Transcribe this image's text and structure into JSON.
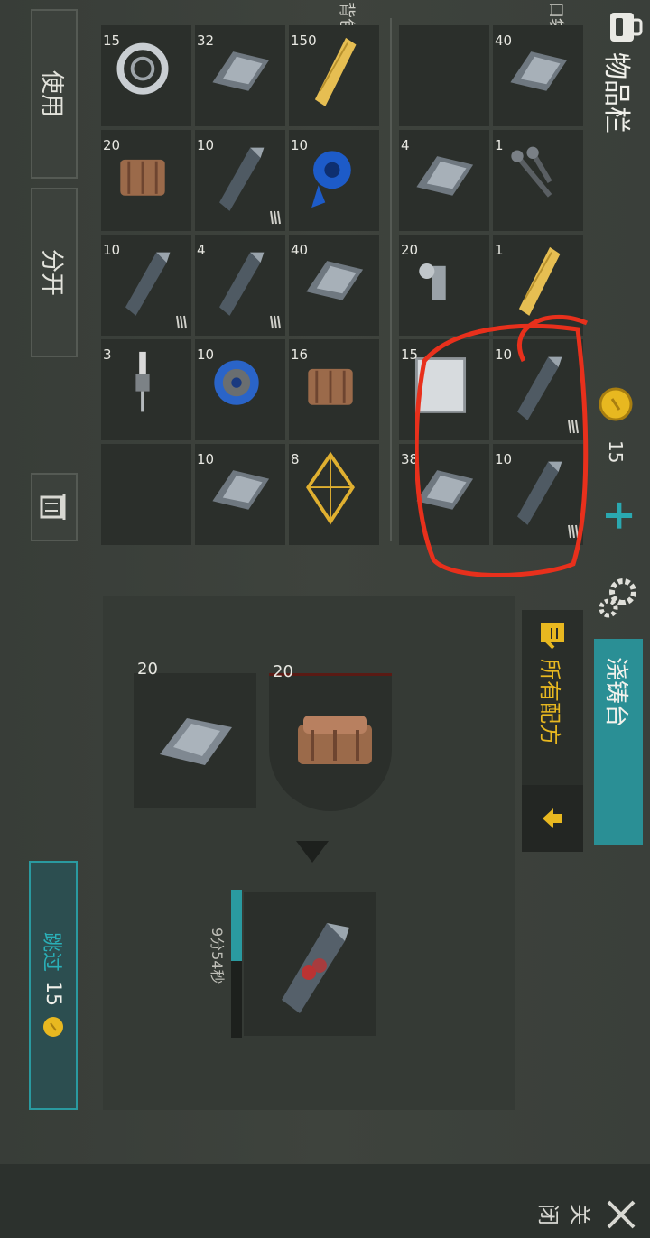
{
  "header": {
    "inventory_title": "物品栏",
    "pocket_label": "口袋",
    "backpack_label": "背包"
  },
  "currency": {
    "coins": "15",
    "add": "+"
  },
  "side_buttons": {
    "use": "使用",
    "split": "分开",
    "skip_label": "跳过",
    "skip_cost": "15"
  },
  "crafting": {
    "station_tab": "浇铸台",
    "all_recipes": "所有配方",
    "timer": "9分54秒",
    "ingredients": [
      {
        "icon": "clay-brick-icon",
        "count": "20"
      },
      {
        "icon": "iron-ingot-icon",
        "count": "20"
      }
    ],
    "result_icon": "iron-bar-icon"
  },
  "pocket": [
    [
      {
        "icon": "iron-ingot-icon",
        "count": "40"
      },
      {
        "icon": "screws-icon",
        "count": "1"
      },
      {
        "icon": "wood-plank-icon",
        "count": "1"
      },
      {
        "icon": "iron-bar-icon",
        "count": "10"
      },
      {
        "icon": "iron-bar-icon",
        "count": "10"
      }
    ],
    [
      {
        "icon": "empty",
        "count": ""
      },
      {
        "icon": "iron-ingot-icon",
        "count": "4"
      },
      {
        "icon": "nut-bolt-icon",
        "count": "20"
      },
      {
        "icon": "metal-sheet-icon",
        "count": "15"
      },
      {
        "icon": "iron-ingot-icon",
        "count": "38"
      }
    ]
  ],
  "backpack": [
    [
      {
        "icon": "wood-plank-icon",
        "count": "150"
      },
      {
        "icon": "duct-tape-icon",
        "count": "10"
      },
      {
        "icon": "iron-ingot-icon",
        "count": "40"
      },
      {
        "icon": "clay-brick-icon",
        "count": "16"
      },
      {
        "icon": "crystal-icon",
        "count": "8"
      }
    ],
    [
      {
        "icon": "iron-ingot-icon",
        "count": "32"
      },
      {
        "icon": "iron-bar-icon",
        "count": "10"
      },
      {
        "icon": "iron-bar-icon",
        "count": "4"
      },
      {
        "icon": "wire-spool-icon",
        "count": "10"
      },
      {
        "icon": "iron-ingot-icon",
        "count": "10"
      }
    ],
    [
      {
        "icon": "bearing-icon",
        "count": "15"
      },
      {
        "icon": "clay-brick-icon",
        "count": "20"
      },
      {
        "icon": "iron-bar-icon",
        "count": "10"
      },
      {
        "icon": "spark-plug-icon",
        "count": "3"
      },
      {
        "icon": "empty",
        "count": ""
      }
    ]
  ],
  "footer": {
    "close": "关闭"
  },
  "colors": {
    "accent": "#2a9aa0",
    "gold": "#e8b820",
    "highlight": "#e8301c"
  }
}
